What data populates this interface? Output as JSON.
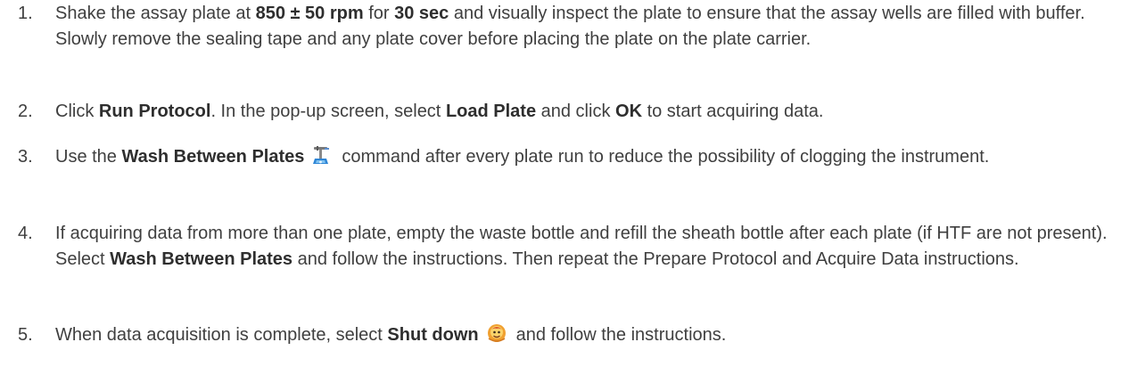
{
  "steps": [
    {
      "number": "1.",
      "parts": {
        "t1": "Shake the assay plate at ",
        "b1": "850 ± 50 rpm",
        "t2": " for ",
        "b2": "30 sec",
        "t3": " and visually inspect the plate to ensure that the assay wells are filled with buffer. Slowly remove the sealing tape and any plate cover before placing the plate on the plate carrier."
      }
    },
    {
      "number": "2.",
      "parts": {
        "t1": "Click ",
        "b1": "Run Protocol",
        "t2": ". In the pop-up screen, select ",
        "b2": "Load Plate",
        "t3": " and click ",
        "b3": "OK",
        "t4": " to start acquiring data."
      }
    },
    {
      "number": "3.",
      "parts": {
        "t1": "Use the ",
        "b1": "Wash Between Plates",
        "t2": "command after every plate run to reduce the possibility of clogging the instrument."
      },
      "icon": "wash-between-plates-icon"
    },
    {
      "number": "4.",
      "parts": {
        "t1": "If acquiring data from more than one plate, empty the waste bottle and refill the sheath bottle after each plate (if HTF are not present). Select ",
        "b1": "Wash Between Plates",
        "t2": " and follow the instructions. Then repeat the Prepare Protocol and Acquire Data instructions."
      }
    },
    {
      "number": "5.",
      "parts": {
        "t1": "When data acquisition is complete, select ",
        "b1": "Shut down",
        "t2": "and follow the instructions."
      },
      "icon": "shut-down-icon"
    }
  ]
}
